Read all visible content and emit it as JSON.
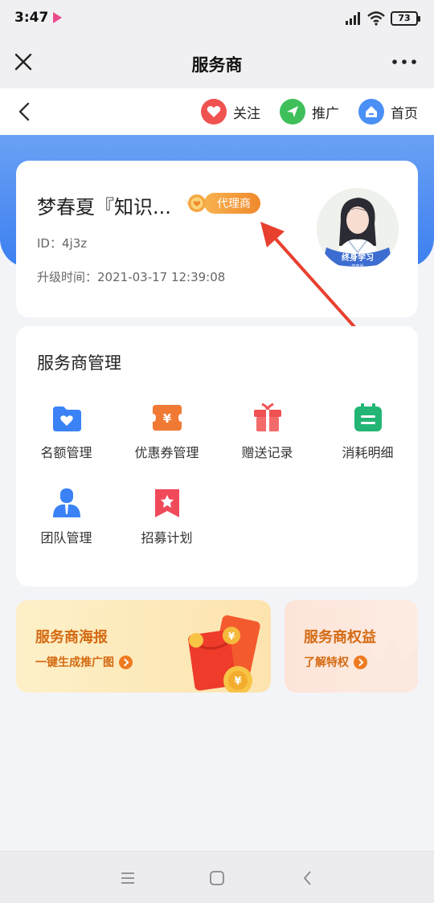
{
  "status_bar": {
    "time": "3:47",
    "battery": "73"
  },
  "title_bar": {
    "title": "服务商"
  },
  "nav_bar": {
    "follow_label": "关注",
    "promote_label": "推广",
    "home_label": "首页"
  },
  "profile": {
    "name": "梦春夏『知识...",
    "badge": "代理商",
    "id_label": "ID：",
    "id_value": "4j3z",
    "upgrade_label": "升级时间：",
    "upgrade_time": "2021-03-17 12:39:08",
    "avatar_text_1": "终身学习",
    "avatar_text_2": "梦春夏"
  },
  "management": {
    "title": "服务商管理",
    "items": [
      {
        "label": "名额管理",
        "icon": "folder-heart-icon",
        "color": "#3b82f6"
      },
      {
        "label": "优惠券管理",
        "icon": "coupon-icon",
        "color": "#f07a34"
      },
      {
        "label": "赠送记录",
        "icon": "gift-icon",
        "color": "#f05252"
      },
      {
        "label": "消耗明细",
        "icon": "calendar-list-icon",
        "color": "#22b573"
      },
      {
        "label": "团队管理",
        "icon": "person-icon",
        "color": "#3b82f6"
      },
      {
        "label": "招募计划",
        "icon": "star-banner-icon",
        "color": "#f04a5a"
      }
    ]
  },
  "promos": {
    "poster_title": "服务商海报",
    "poster_sub": "一键生成推广图",
    "rights_title": "服务商权益",
    "rights_sub": "了解特权"
  },
  "colors": {
    "accent_blue": "#3c7ff0",
    "badge_orange": "#f0892c",
    "arrow_red": "#e8402f",
    "promo_text_orange": "#d46a12"
  }
}
